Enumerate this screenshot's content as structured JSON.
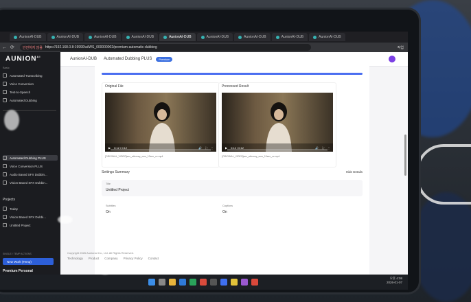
{
  "browser": {
    "tabs": [
      "AunionAI-DUB",
      "AunionAI-DUB",
      "AunionAI-DUB",
      "AunionAI-DUB",
      "AunionAI-DUB",
      "AunionAI-DUB",
      "AunionAI-DUB",
      "AunionAI-DUB",
      "AunionAI-DUB"
    ],
    "active_tab_index": 4,
    "url_warning": "안전하지 않음",
    "url": "https://192.168.0.8:19990/ai/WS_000000002/premium-automatic-dubbing",
    "profile_label": "작업"
  },
  "sidebar": {
    "logo": "AUNION",
    "logo_sup": "AI",
    "section_label": "Basic",
    "items": [
      "Automated Transcribing",
      "Voice Conversion",
      "Text-to-Speech",
      "Automated Dubbing"
    ],
    "premium_items": [
      "Automated Dubbing PLUS",
      "Voice Conversion PLUS",
      "Audio Based SFX Dubbin...",
      "Vision Based SFX Dubbin..."
    ],
    "projects_label": "Projects",
    "project_items": [
      "Today",
      "Vision Based SFX Dubbi...",
      "Untitled Project"
    ],
    "new_work_section": "SINGLE / TEMP ACTIONS",
    "new_work_button": "New Work (Temp)",
    "plan_label": "Premium Personal"
  },
  "header": {
    "app_name": "AunionAI-DUB",
    "page_title": "Automated Dubbing PLUS",
    "badge": "Premium"
  },
  "progress": {
    "value": 1.0
  },
  "cards": [
    {
      "title": "Original File",
      "time": "0:12 / 0:12",
      "filename": "[ORIGINAL_VIDEO]sec_attorney_woo_10sec_cc.mp4"
    },
    {
      "title": "Processed Result",
      "time": "0:12 / 0:12",
      "filename": "[ORIGINAL_VIDEO]sec_attorney_woo_10sec_cc.mp4"
    }
  ],
  "settings": {
    "title": "Settings Summary",
    "hide_label": "Hide Details",
    "title_label": "Title",
    "title_value": "Untitled Project",
    "subtitles_label": "Subtitles",
    "subtitles_value": "On",
    "captions_label": "Captions",
    "captions_value": "On"
  },
  "footer": {
    "copyright": "Copyright 2026 Aunionai Co., Ltd. All Rights Reserved.",
    "links": [
      "Technology",
      "Product",
      "Company",
      "Privacy Policy",
      "Contact"
    ]
  },
  "taskbar": {
    "time": "오후 4:08",
    "date": "2026-01-07"
  },
  "colors": {
    "accent": "#3b6fe0",
    "avatar": "#7b3fe4",
    "sidebar_bg": "#1b1c20"
  }
}
